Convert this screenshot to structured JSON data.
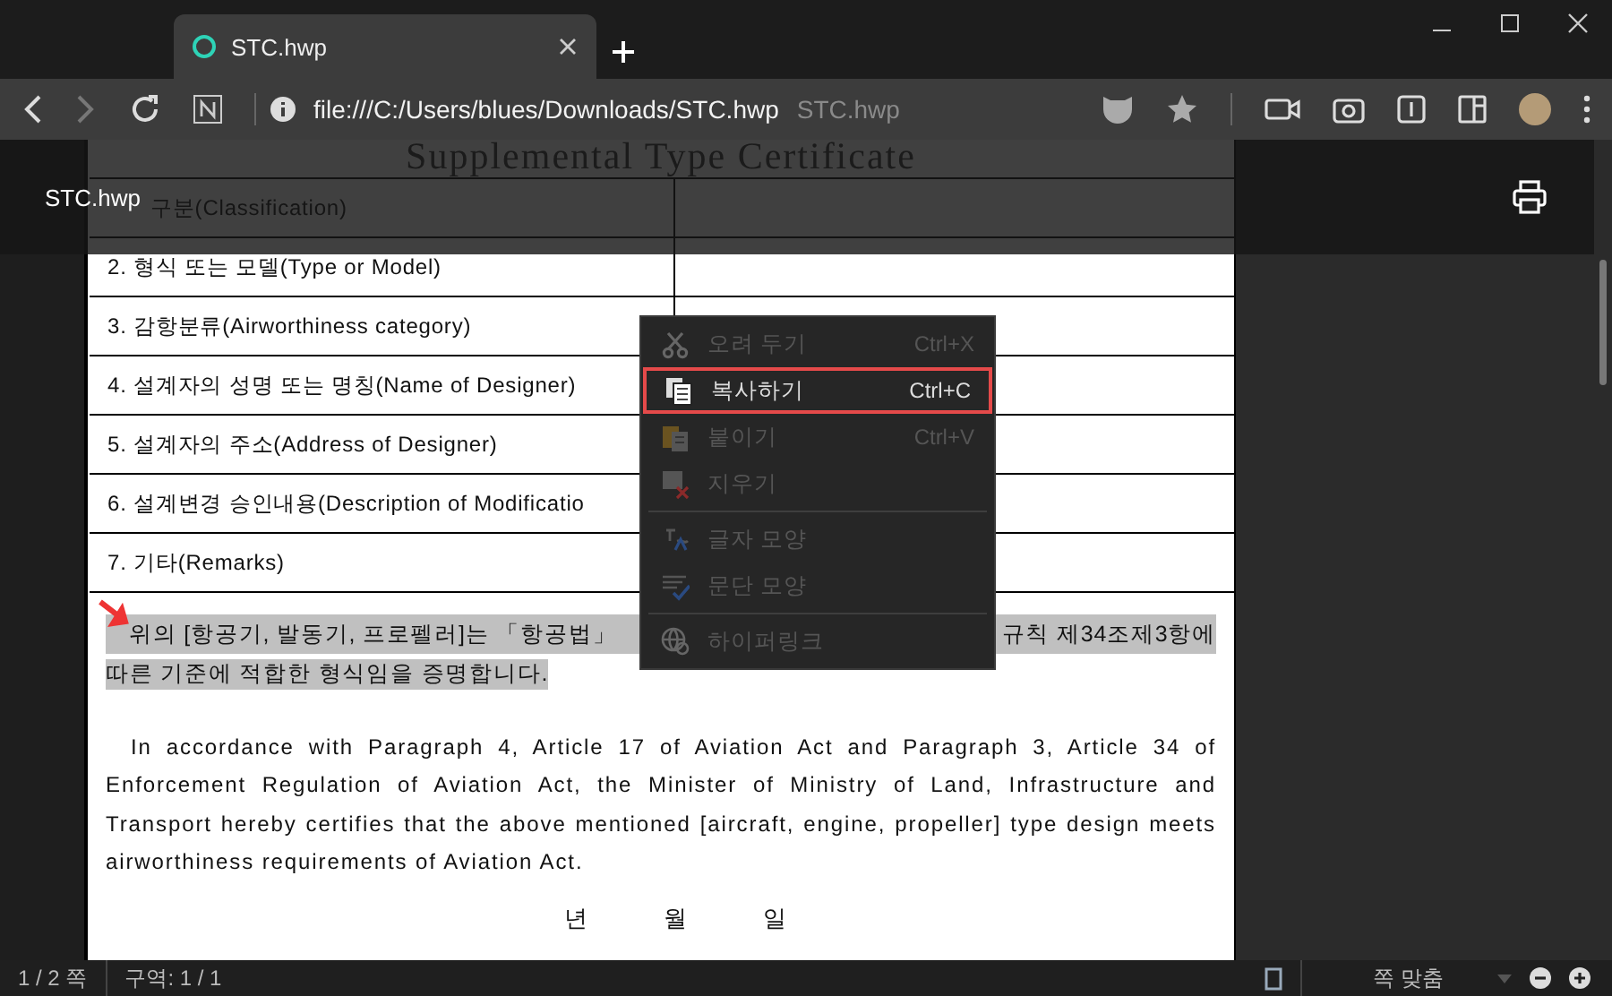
{
  "browser": {
    "tab": {
      "title": "STC.hwp",
      "selected": true
    },
    "address": {
      "url": "file:///C:/Users/blues/Downloads/STC.hwp",
      "page_title": "STC.hwp"
    }
  },
  "viewer": {
    "title": "STC.hwp"
  },
  "document": {
    "title": "Supplemental Type Certificate",
    "rows": [
      {
        "label": "구분(Classification)"
      },
      {
        "label": "2. 형식 또는 모델(Type or Model)"
      },
      {
        "label": "3. 감항분류(Airworthiness category)"
      },
      {
        "label": "4. 설계자의 성명 또는 명칭(Name of Designer)"
      },
      {
        "label": "5. 설계자의 주소(Address of Designer)"
      },
      {
        "label": "6. 설계변경 승인내용(Description of Modificatio"
      },
      {
        "label": "7. 기타(Remarks)"
      }
    ],
    "korean_paragraph": {
      "highlighted": true,
      "line_1_start": "위의 [항공기, 발동기, 프로펠러]는 「항공법」",
      "line_1_end": "규칙 제34조제3항에",
      "line_2": "따른 기준에 적합한 형식임을 증명합니다."
    },
    "english_paragraph": "In accordance with Paragraph 4, Article 17 of Aviation Act and Paragraph 3, Article 34 of Enforcement Regulation of Aviation Act, the Minister of Ministry of Land, Infrastructure and Transport hereby certifies that the above mentioned [aircraft, engine, propeller] type design meets airworthiness requirements of Aviation Act.",
    "date_labels": [
      "년",
      "월",
      "일"
    ]
  },
  "context_menu": [
    {
      "kind": "item",
      "label": "오려 두기",
      "shortcut": "Ctrl+X",
      "disabled": true,
      "selected": false
    },
    {
      "kind": "item",
      "label": "복사하기",
      "shortcut": "Ctrl+C",
      "disabled": false,
      "selected": true
    },
    {
      "kind": "item",
      "label": "붙이기",
      "shortcut": "Ctrl+V",
      "disabled": true,
      "selected": false
    },
    {
      "kind": "item",
      "label": "지우기",
      "disabled": true,
      "selected": false
    },
    {
      "kind": "separator"
    },
    {
      "kind": "item",
      "label": "글자 모양",
      "disabled": true,
      "selected": false
    },
    {
      "kind": "item",
      "label": "문단 모양",
      "disabled": true,
      "selected": false
    },
    {
      "kind": "separator"
    },
    {
      "kind": "item",
      "label": "하이퍼링크",
      "disabled": true,
      "selected": false
    }
  ],
  "status_bar": {
    "page": "1 / 2 쪽",
    "section": "구역: 1 / 1",
    "zoom": "쪽 맞춤"
  }
}
